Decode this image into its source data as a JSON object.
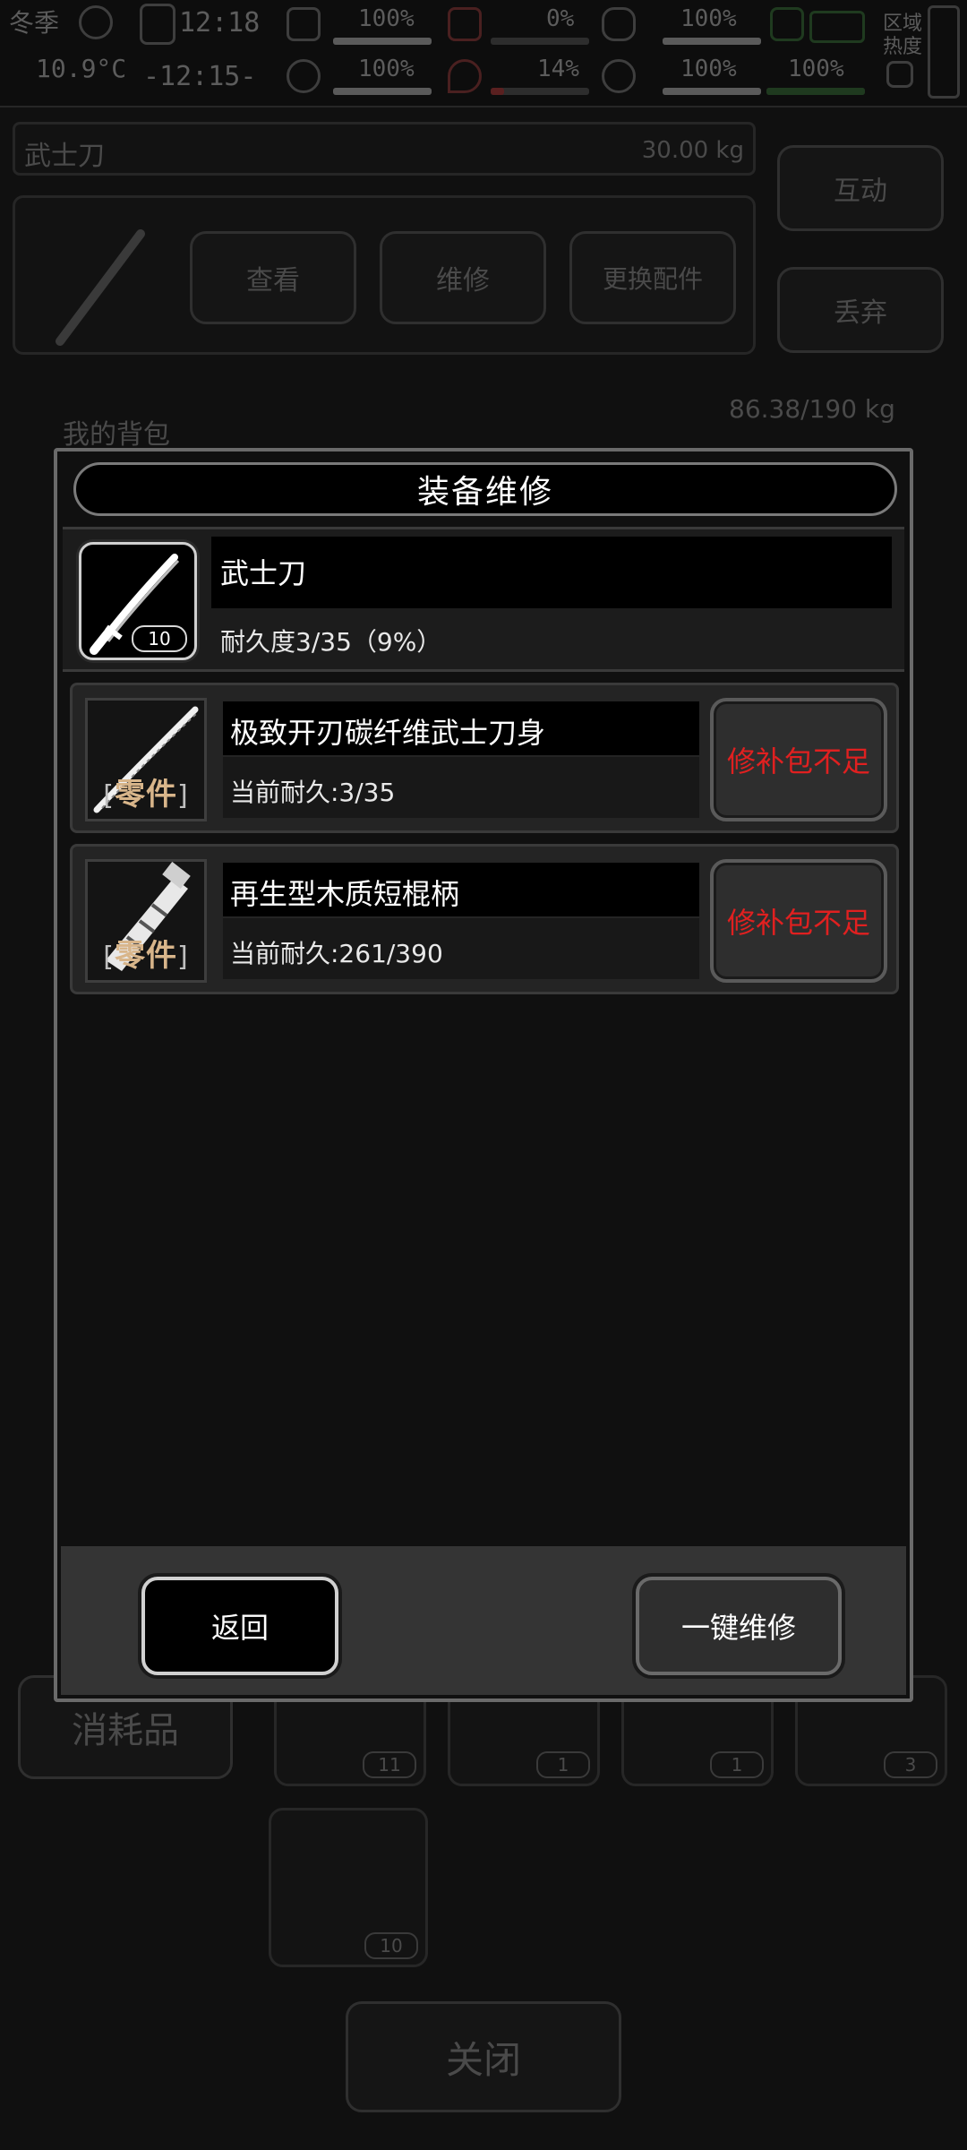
{
  "status_bar": {
    "season": "冬季",
    "clock": "12:18",
    "temperature": "10.9°C",
    "time2": "-12:15-",
    "stat_a1": "100%",
    "stat_a2": "0%",
    "stat_a3": "100%",
    "stat_b1": "100%",
    "stat_b2": "14%",
    "stat_b3": "100%",
    "stat_b4": "100%",
    "area_heat_label": "区域热度"
  },
  "background": {
    "item_title": "武士刀",
    "item_weight": "30.00 kg",
    "btn_interact": "互动",
    "btn_view": "查看",
    "btn_repair": "维修",
    "btn_replace": "更换配件",
    "btn_discard": "丢弃",
    "backpack_label": "我的背包",
    "backpack_weight": "86.38/190 kg",
    "consumables": "消耗品",
    "counts": [
      "11",
      "1",
      "1",
      "3",
      "10"
    ],
    "close": "关闭"
  },
  "modal": {
    "title": "装备维修",
    "item": {
      "name": "武士刀",
      "count": "10",
      "durability": "耐久度3/35（9%）"
    },
    "parts": [
      {
        "name": "极致开刃碳纤维武士刀身",
        "tag": "零件",
        "durability": "当前耐久:3/35",
        "action": "修补包不足"
      },
      {
        "name": "再生型木质短棍柄",
        "tag": "零件",
        "durability": "当前耐久:261/390",
        "action": "修补包不足"
      }
    ],
    "back_button": "返回",
    "repair_all_button": "一键维修"
  },
  "colors": {
    "warning": "#e02020",
    "part_tag": "#d8b58a"
  },
  "icons": [
    "katana-icon",
    "blade-icon",
    "handle-icon"
  ]
}
